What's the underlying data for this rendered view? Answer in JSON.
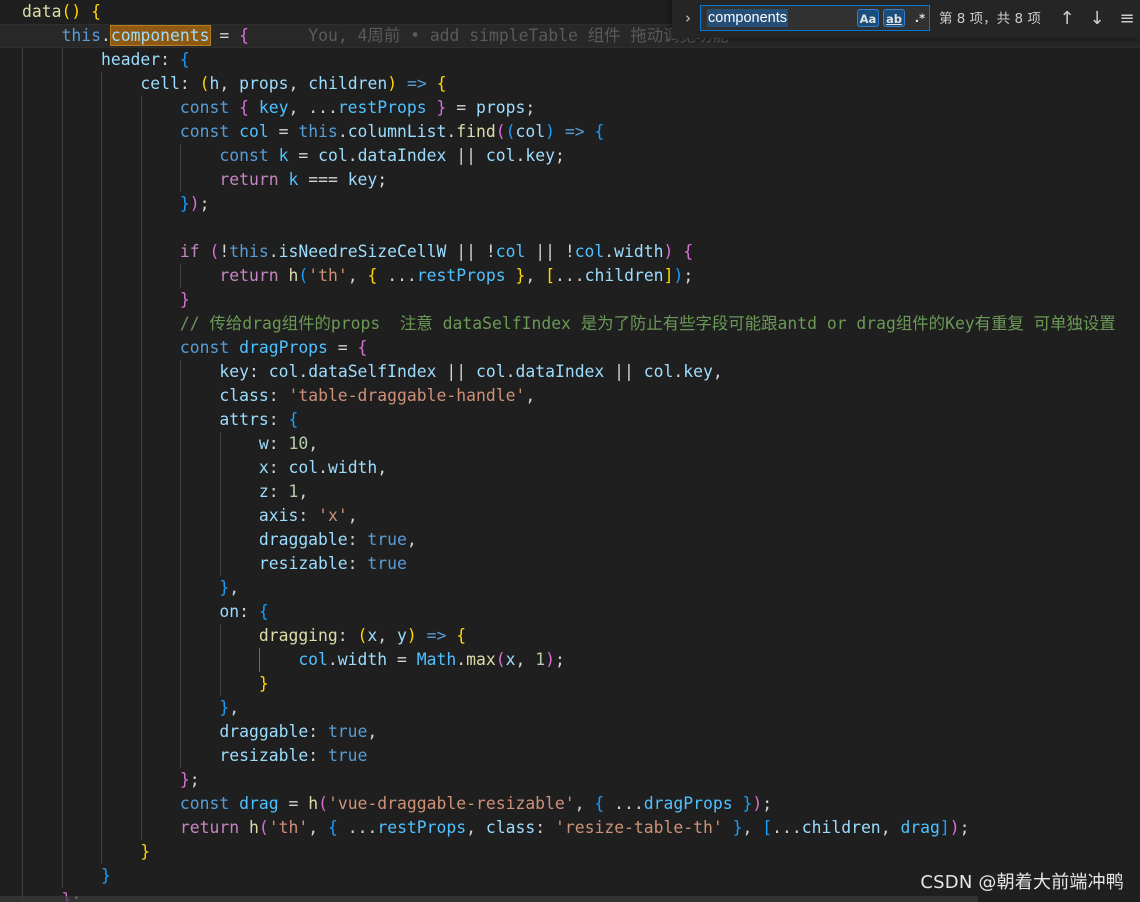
{
  "find_widget": {
    "toggle_glyph": "›",
    "query": "components",
    "match_case_label": "Aa",
    "whole_word_label": "ab",
    "regex_label": ".*",
    "result_count": "第 8 项，共 8 项",
    "prev_glyph": "↑",
    "next_glyph": "↓",
    "more_glyph": "≡"
  },
  "blame": "You, 4周前 • add simpleTable 组件 拖动调宽功能",
  "watermark": "CSDN @朝着大前端冲鸭",
  "colors": {
    "background": "#1f1f1f",
    "keyword": "#569cd6",
    "control": "#c586c0",
    "function": "#dcdcaa",
    "string": "#ce9178",
    "number": "#b5cea8",
    "comment": "#6a9955",
    "find_highlight": "#8f5a0f"
  },
  "lines": [
    [
      [
        "fn",
        "data"
      ],
      [
        "b1",
        "()"
      ],
      [
        "pl",
        " "
      ],
      [
        "b1",
        "{"
      ]
    ],
    [
      [
        "pl",
        "    "
      ],
      [
        "kw",
        "this"
      ],
      [
        "pl",
        "."
      ],
      [
        "hl",
        "components"
      ],
      [
        "pl",
        " = "
      ],
      [
        "b2",
        "{"
      ],
      [
        "blame",
        "      You, 4周前 • add simpleTable 组件 拖动调宽功能"
      ]
    ],
    [
      [
        "pl",
        "        "
      ],
      [
        "prop",
        "header"
      ],
      [
        "pl",
        ": "
      ],
      [
        "b3",
        "{"
      ]
    ],
    [
      [
        "pl",
        "            "
      ],
      [
        "prop",
        "cell"
      ],
      [
        "pl",
        ": "
      ],
      [
        "b1",
        "("
      ],
      [
        "var",
        "h"
      ],
      [
        "pl",
        ", "
      ],
      [
        "var",
        "props"
      ],
      [
        "pl",
        ", "
      ],
      [
        "var",
        "children"
      ],
      [
        "b1",
        ")"
      ],
      [
        "pl",
        " "
      ],
      [
        "kw",
        "=>"
      ],
      [
        "pl",
        " "
      ],
      [
        "b1",
        "{"
      ]
    ],
    [
      [
        "pl",
        "                "
      ],
      [
        "kw",
        "const"
      ],
      [
        "pl",
        " "
      ],
      [
        "b2",
        "{"
      ],
      [
        "pl",
        " "
      ],
      [
        "cnst",
        "key"
      ],
      [
        "pl",
        ", ..."
      ],
      [
        "cnst",
        "restProps"
      ],
      [
        "pl",
        " "
      ],
      [
        "b2",
        "}"
      ],
      [
        "pl",
        " = "
      ],
      [
        "var",
        "props"
      ],
      [
        "pl",
        ";"
      ]
    ],
    [
      [
        "pl",
        "                "
      ],
      [
        "kw",
        "const"
      ],
      [
        "pl",
        " "
      ],
      [
        "cnst",
        "col"
      ],
      [
        "pl",
        " = "
      ],
      [
        "kw",
        "this"
      ],
      [
        "pl",
        "."
      ],
      [
        "prop",
        "columnList"
      ],
      [
        "pl",
        "."
      ],
      [
        "fn",
        "find"
      ],
      [
        "b2",
        "("
      ],
      [
        "b3",
        "("
      ],
      [
        "var",
        "col"
      ],
      [
        "b3",
        ")"
      ],
      [
        "pl",
        " "
      ],
      [
        "kw",
        "=>"
      ],
      [
        "pl",
        " "
      ],
      [
        "b3",
        "{"
      ]
    ],
    [
      [
        "pl",
        "                    "
      ],
      [
        "kw",
        "const"
      ],
      [
        "pl",
        " "
      ],
      [
        "cnst",
        "k"
      ],
      [
        "pl",
        " = "
      ],
      [
        "var",
        "col"
      ],
      [
        "pl",
        "."
      ],
      [
        "prop",
        "dataIndex"
      ],
      [
        "pl",
        " || "
      ],
      [
        "var",
        "col"
      ],
      [
        "pl",
        "."
      ],
      [
        "prop",
        "key"
      ],
      [
        "pl",
        ";"
      ]
    ],
    [
      [
        "pl",
        "                    "
      ],
      [
        "ctl",
        "return"
      ],
      [
        "pl",
        " "
      ],
      [
        "cnst",
        "k"
      ],
      [
        "pl",
        " === "
      ],
      [
        "var",
        "key"
      ],
      [
        "pl",
        ";"
      ]
    ],
    [
      [
        "pl",
        "                "
      ],
      [
        "b3",
        "}"
      ],
      [
        "b2",
        ")"
      ],
      [
        "pl",
        ";"
      ]
    ],
    [
      [
        "pl",
        ""
      ]
    ],
    [
      [
        "pl",
        "                "
      ],
      [
        "ctl",
        "if"
      ],
      [
        "pl",
        " "
      ],
      [
        "b2",
        "("
      ],
      [
        "pl",
        "!"
      ],
      [
        "kw",
        "this"
      ],
      [
        "pl",
        "."
      ],
      [
        "prop",
        "isNeedreSizeCellW"
      ],
      [
        "pl",
        " || !"
      ],
      [
        "cnst",
        "col"
      ],
      [
        "pl",
        " || !"
      ],
      [
        "cnst",
        "col"
      ],
      [
        "pl",
        "."
      ],
      [
        "prop",
        "width"
      ],
      [
        "b2",
        ")"
      ],
      [
        "pl",
        " "
      ],
      [
        "b2",
        "{"
      ]
    ],
    [
      [
        "pl",
        "                    "
      ],
      [
        "ctl",
        "return"
      ],
      [
        "pl",
        " "
      ],
      [
        "fn",
        "h"
      ],
      [
        "b3",
        "("
      ],
      [
        "str",
        "'th'"
      ],
      [
        "pl",
        ", "
      ],
      [
        "b1",
        "{"
      ],
      [
        "pl",
        " ..."
      ],
      [
        "cnst",
        "restProps"
      ],
      [
        "pl",
        " "
      ],
      [
        "b1",
        "}"
      ],
      [
        "pl",
        ", "
      ],
      [
        "b1",
        "["
      ],
      [
        "pl",
        "..."
      ],
      [
        "var",
        "children"
      ],
      [
        "b1",
        "]"
      ],
      [
        "b3",
        ")"
      ],
      [
        "pl",
        ";"
      ]
    ],
    [
      [
        "pl",
        "                "
      ],
      [
        "b2",
        "}"
      ]
    ],
    [
      [
        "pl",
        "                "
      ],
      [
        "cmt",
        "// 传给drag组件的props  注意 dataSelfIndex 是为了防止有些字段可能跟antd or drag组件的Key有重复 可单独设置"
      ]
    ],
    [
      [
        "pl",
        "                "
      ],
      [
        "kw",
        "const"
      ],
      [
        "pl",
        " "
      ],
      [
        "cnst",
        "dragProps"
      ],
      [
        "pl",
        " = "
      ],
      [
        "b2",
        "{"
      ]
    ],
    [
      [
        "pl",
        "                    "
      ],
      [
        "prop",
        "key"
      ],
      [
        "pl",
        ": "
      ],
      [
        "var",
        "col"
      ],
      [
        "pl",
        "."
      ],
      [
        "prop",
        "dataSelfIndex"
      ],
      [
        "pl",
        " || "
      ],
      [
        "var",
        "col"
      ],
      [
        "pl",
        "."
      ],
      [
        "prop",
        "dataIndex"
      ],
      [
        "pl",
        " || "
      ],
      [
        "var",
        "col"
      ],
      [
        "pl",
        "."
      ],
      [
        "prop",
        "key"
      ],
      [
        "pl",
        ","
      ]
    ],
    [
      [
        "pl",
        "                    "
      ],
      [
        "prop",
        "class"
      ],
      [
        "pl",
        ": "
      ],
      [
        "str",
        "'table-draggable-handle'"
      ],
      [
        "pl",
        ","
      ]
    ],
    [
      [
        "pl",
        "                    "
      ],
      [
        "prop",
        "attrs"
      ],
      [
        "pl",
        ": "
      ],
      [
        "b3",
        "{"
      ]
    ],
    [
      [
        "pl",
        "                        "
      ],
      [
        "prop",
        "w"
      ],
      [
        "pl",
        ": "
      ],
      [
        "num",
        "10"
      ],
      [
        "pl",
        ","
      ]
    ],
    [
      [
        "pl",
        "                        "
      ],
      [
        "prop",
        "x"
      ],
      [
        "pl",
        ": "
      ],
      [
        "var",
        "col"
      ],
      [
        "pl",
        "."
      ],
      [
        "prop",
        "width"
      ],
      [
        "pl",
        ","
      ]
    ],
    [
      [
        "pl",
        "                        "
      ],
      [
        "prop",
        "z"
      ],
      [
        "pl",
        ": "
      ],
      [
        "num",
        "1"
      ],
      [
        "pl",
        ","
      ]
    ],
    [
      [
        "pl",
        "                        "
      ],
      [
        "prop",
        "axis"
      ],
      [
        "pl",
        ": "
      ],
      [
        "str",
        "'x'"
      ],
      [
        "pl",
        ","
      ]
    ],
    [
      [
        "pl",
        "                        "
      ],
      [
        "prop",
        "draggable"
      ],
      [
        "pl",
        ": "
      ],
      [
        "kw",
        "true"
      ],
      [
        "pl",
        ","
      ]
    ],
    [
      [
        "pl",
        "                        "
      ],
      [
        "prop",
        "resizable"
      ],
      [
        "pl",
        ": "
      ],
      [
        "kw",
        "true"
      ]
    ],
    [
      [
        "pl",
        "                    "
      ],
      [
        "b3",
        "}"
      ],
      [
        "pl",
        ","
      ]
    ],
    [
      [
        "pl",
        "                    "
      ],
      [
        "prop",
        "on"
      ],
      [
        "pl",
        ": "
      ],
      [
        "b3",
        "{"
      ]
    ],
    [
      [
        "pl",
        "                        "
      ],
      [
        "fn",
        "dragging"
      ],
      [
        "pl",
        ": "
      ],
      [
        "b1",
        "("
      ],
      [
        "var",
        "x"
      ],
      [
        "pl",
        ", "
      ],
      [
        "var",
        "y"
      ],
      [
        "b1",
        ")"
      ],
      [
        "pl",
        " "
      ],
      [
        "kw",
        "=>"
      ],
      [
        "pl",
        " "
      ],
      [
        "b1",
        "{"
      ]
    ],
    [
      [
        "pl",
        "                            "
      ],
      [
        "cnst",
        "col"
      ],
      [
        "pl",
        "."
      ],
      [
        "prop",
        "width"
      ],
      [
        "pl",
        " = "
      ],
      [
        "cnst",
        "Math"
      ],
      [
        "pl",
        "."
      ],
      [
        "fn",
        "max"
      ],
      [
        "b2",
        "("
      ],
      [
        "var",
        "x"
      ],
      [
        "pl",
        ", "
      ],
      [
        "num",
        "1"
      ],
      [
        "b2",
        ")"
      ],
      [
        "pl",
        ";"
      ]
    ],
    [
      [
        "pl",
        "                        "
      ],
      [
        "b1",
        "}"
      ]
    ],
    [
      [
        "pl",
        "                    "
      ],
      [
        "b3",
        "}"
      ],
      [
        "pl",
        ","
      ]
    ],
    [
      [
        "pl",
        "                    "
      ],
      [
        "prop",
        "draggable"
      ],
      [
        "pl",
        ": "
      ],
      [
        "kw",
        "true"
      ],
      [
        "pl",
        ","
      ]
    ],
    [
      [
        "pl",
        "                    "
      ],
      [
        "prop",
        "resizable"
      ],
      [
        "pl",
        ": "
      ],
      [
        "kw",
        "true"
      ]
    ],
    [
      [
        "pl",
        "                "
      ],
      [
        "b2",
        "}"
      ],
      [
        "pl",
        ";"
      ]
    ],
    [
      [
        "pl",
        "                "
      ],
      [
        "kw",
        "const"
      ],
      [
        "pl",
        " "
      ],
      [
        "cnst",
        "drag"
      ],
      [
        "pl",
        " = "
      ],
      [
        "fn",
        "h"
      ],
      [
        "b2",
        "("
      ],
      [
        "str",
        "'vue-draggable-resizable'"
      ],
      [
        "pl",
        ", "
      ],
      [
        "b3",
        "{"
      ],
      [
        "pl",
        " ..."
      ],
      [
        "cnst",
        "dragProps"
      ],
      [
        "pl",
        " "
      ],
      [
        "b3",
        "}"
      ],
      [
        "b2",
        ")"
      ],
      [
        "pl",
        ";"
      ]
    ],
    [
      [
        "pl",
        "                "
      ],
      [
        "ctl",
        "return"
      ],
      [
        "pl",
        " "
      ],
      [
        "fn",
        "h"
      ],
      [
        "b2",
        "("
      ],
      [
        "str",
        "'th'"
      ],
      [
        "pl",
        ", "
      ],
      [
        "b3",
        "{"
      ],
      [
        "pl",
        " ..."
      ],
      [
        "cnst",
        "restProps"
      ],
      [
        "pl",
        ", "
      ],
      [
        "prop",
        "class"
      ],
      [
        "pl",
        ": "
      ],
      [
        "str",
        "'resize-table-th'"
      ],
      [
        "pl",
        " "
      ],
      [
        "b3",
        "}"
      ],
      [
        "pl",
        ", "
      ],
      [
        "b3",
        "["
      ],
      [
        "pl",
        "..."
      ],
      [
        "var",
        "children"
      ],
      [
        "pl",
        ", "
      ],
      [
        "cnst",
        "drag"
      ],
      [
        "b3",
        "]"
      ],
      [
        "b2",
        ")"
      ],
      [
        "pl",
        ";"
      ]
    ],
    [
      [
        "pl",
        "            "
      ],
      [
        "b1",
        "}"
      ]
    ],
    [
      [
        "pl",
        "        "
      ],
      [
        "b3",
        "}"
      ]
    ],
    [
      [
        "pl",
        "    "
      ],
      [
        "b2",
        "}"
      ],
      [
        "pl",
        ";"
      ]
    ]
  ]
}
